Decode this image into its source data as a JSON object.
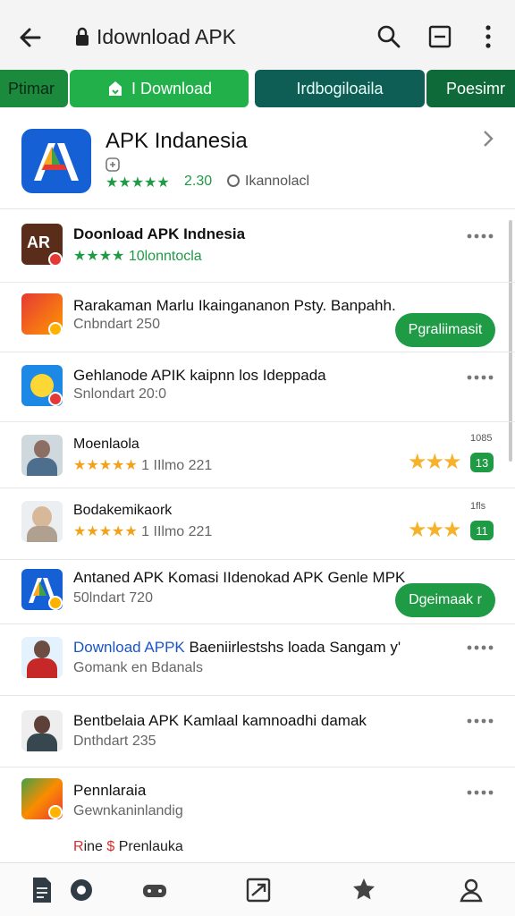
{
  "address_bar": {
    "url": "Idownload APK"
  },
  "tabs": [
    {
      "label": "Ptimar"
    },
    {
      "label": "I Download"
    },
    {
      "label": "Irdbogiloaila"
    },
    {
      "label": "Poesimr"
    }
  ],
  "hero": {
    "title": "APK Indanesia",
    "stars": "★★★★★",
    "rating": "2.30",
    "downloads": "Ikannolacl"
  },
  "list": [
    {
      "title": "Doonload APK Indnesia",
      "stars": "★★★★",
      "subtitle": "10lonntocla"
    },
    {
      "title": "Rarakaman Marlu Ikaingananon Psty. Banpahh.",
      "subtitle": "Cnbndart 250",
      "button": "Pgraliimasit"
    },
    {
      "title": "Gehlanode APIK kaipnn los Ideppada",
      "subtitle": "Snlondart 20:0"
    },
    {
      "title": "Moenlaola",
      "stars": "★★★★★",
      "subtitle_rest": "1 IIlmo 221",
      "big_stars": "★★★",
      "count_small": "1085",
      "count_badge": "13"
    },
    {
      "title": "Bodakemikaork",
      "stars": "★★★★★",
      "subtitle_rest": "1 IIlmo 221",
      "big_stars": "★★★",
      "count_small": "1fls",
      "count_badge": "11"
    },
    {
      "title": "Antaned APK Komasi IIdenokad APK Genle MPK",
      "subtitle": "50lndart 720",
      "button": "Dgeimaak r"
    },
    {
      "title_blue": "Download APPK",
      "title_rest": " Baeniirlestshs loada Sangam y'",
      "subtitle": "Gomank en Bdanals"
    },
    {
      "title": "Bentbelaia APK Kamlaal kamnoadhi damak",
      "subtitle": "Dnthdart 235"
    },
    {
      "title": "Pennlaraia",
      "subtitle": "Gewnkaninlandig"
    }
  ],
  "footer_text": {
    "red1": "R",
    "mid": "ine ",
    "red2": "$",
    "rest": " Prenlauka"
  },
  "colors": {
    "brand_green": "#22b04a",
    "dark_teal": "#0f5e55",
    "rating_green": "#1f9a45",
    "star_gold": "#f5b22a"
  }
}
